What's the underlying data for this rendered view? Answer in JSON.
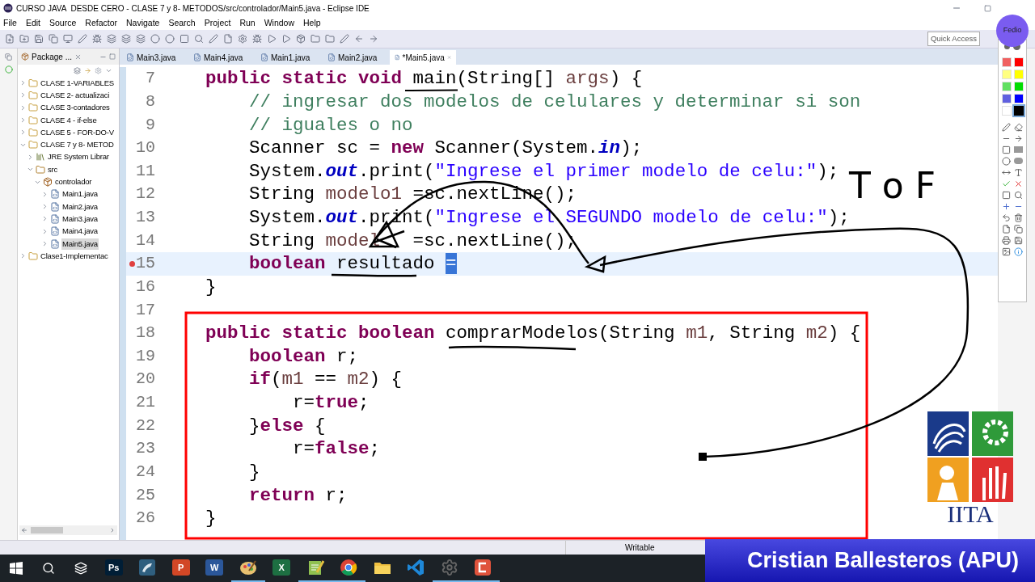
{
  "window": {
    "title": "CURSO JAVA  DESDE CERO - CLASE 7 y 8- METODOS/src/controlador/Main5.java - Eclipse IDE"
  },
  "menu": [
    "File",
    "Edit",
    "Source",
    "Refactor",
    "Navigate",
    "Search",
    "Project",
    "Run",
    "Window",
    "Help"
  ],
  "quick_access": {
    "placeholder": "Quick Access"
  },
  "package_explorer": {
    "title": "Package ...",
    "tree": [
      {
        "label": "CLASE 1-VARIABLES",
        "kind": "project",
        "expanded": false,
        "selected": false
      },
      {
        "label": "CLASE 2- actualizaci",
        "kind": "project",
        "expanded": false,
        "selected": false
      },
      {
        "label": "CLASE 3-contadores",
        "kind": "project",
        "expanded": false,
        "selected": false
      },
      {
        "label": "CLASE 4 - if-else",
        "kind": "project",
        "expanded": false,
        "selected": false
      },
      {
        "label": "CLASE 5 - FOR-DO-V",
        "kind": "project",
        "expanded": false,
        "selected": false
      },
      {
        "label": "CLASE 7 y 8- METOD",
        "kind": "project",
        "expanded": true,
        "selected": false,
        "children": [
          {
            "label": "JRE System Librar",
            "kind": "library",
            "expanded": false,
            "selected": false
          },
          {
            "label": "src",
            "kind": "folder",
            "expanded": true,
            "selected": false,
            "children": [
              {
                "label": "controlador",
                "kind": "package",
                "expanded": true,
                "selected": false,
                "children": [
                  {
                    "label": "Main1.java",
                    "kind": "file",
                    "expanded": false,
                    "selected": false
                  },
                  {
                    "label": "Main2.java",
                    "kind": "file",
                    "expanded": false,
                    "selected": false
                  },
                  {
                    "label": "Main3.java",
                    "kind": "file",
                    "expanded": false,
                    "selected": false
                  },
                  {
                    "label": "Main4.java",
                    "kind": "file",
                    "expanded": false,
                    "selected": false
                  },
                  {
                    "label": "Main5.java",
                    "kind": "file",
                    "expanded": false,
                    "selected": true
                  }
                ]
              }
            ]
          }
        ]
      },
      {
        "label": "Clase1-Implementac",
        "kind": "project",
        "expanded": false,
        "selected": false
      }
    ]
  },
  "editor": {
    "tabs": [
      {
        "label": "Main3.java",
        "selected": false
      },
      {
        "label": "Main4.java",
        "selected": false
      },
      {
        "label": "Main1.java",
        "selected": false
      },
      {
        "label": "Main2.java",
        "selected": false
      },
      {
        "label": "*Main5.java",
        "selected": true
      }
    ],
    "lines": [
      {
        "number": "7",
        "current": false,
        "error": false,
        "tokens": [
          {
            "text": "    public static void",
            "kind": "kw"
          },
          {
            "text": " main(String[] ",
            "kind": "txt"
          },
          {
            "text": "args",
            "kind": "var"
          },
          {
            "text": ") {",
            "kind": "txt"
          }
        ]
      },
      {
        "number": "8",
        "current": false,
        "error": false,
        "tokens": [
          {
            "text": "        // ingresar dos modelos de celulares y determinar si son",
            "kind": "cm"
          }
        ]
      },
      {
        "number": "9",
        "current": false,
        "error": false,
        "tokens": [
          {
            "text": "        // iguales o no",
            "kind": "cm"
          }
        ]
      },
      {
        "number": "10",
        "current": false,
        "error": false,
        "tokens": [
          {
            "text": "        Scanner sc = ",
            "kind": "txt"
          },
          {
            "text": "new",
            "kind": "kw"
          },
          {
            "text": " Scanner(System.",
            "kind": "txt"
          },
          {
            "text": "in",
            "kind": "fld"
          },
          {
            "text": ");",
            "kind": "txt"
          }
        ]
      },
      {
        "number": "11",
        "current": false,
        "error": false,
        "tokens": [
          {
            "text": "        System.",
            "kind": "txt"
          },
          {
            "text": "out",
            "kind": "fld"
          },
          {
            "text": ".print(",
            "kind": "txt"
          },
          {
            "text": "\"Ingrese el primer modelo de celu:\"",
            "kind": "str"
          },
          {
            "text": ");",
            "kind": "txt"
          }
        ]
      },
      {
        "number": "12",
        "current": false,
        "error": false,
        "tokens": [
          {
            "text": "        String ",
            "kind": "txt"
          },
          {
            "text": "modelo1",
            "kind": "var"
          },
          {
            "text": " =sc.nextLine();",
            "kind": "txt"
          }
        ]
      },
      {
        "number": "13",
        "current": false,
        "error": false,
        "tokens": [
          {
            "text": "        System.",
            "kind": "txt"
          },
          {
            "text": "out",
            "kind": "fld"
          },
          {
            "text": ".print(",
            "kind": "txt"
          },
          {
            "text": "\"Ingrese el SEGUNDO modelo de celu:\"",
            "kind": "str"
          },
          {
            "text": ");",
            "kind": "txt"
          }
        ]
      },
      {
        "number": "14",
        "current": false,
        "error": false,
        "tokens": [
          {
            "text": "        String ",
            "kind": "txt"
          },
          {
            "text": "model",
            "kind": "var"
          },
          {
            "text": "   =sc.nextLine();",
            "kind": "txt"
          }
        ]
      },
      {
        "number": "15",
        "current": true,
        "error": true,
        "tokens": [
          {
            "text": "        boolean",
            "kind": "kw"
          },
          {
            "text": " resultado ",
            "kind": "txt"
          },
          {
            "text": "=",
            "kind": "sel"
          }
        ]
      },
      {
        "number": "16",
        "current": false,
        "error": false,
        "tokens": [
          {
            "text": "    }",
            "kind": "txt"
          }
        ]
      },
      {
        "number": "17",
        "current": false,
        "error": false
      },
      {
        "number": "18",
        "current": false,
        "error": false,
        "tokens": [
          {
            "text": "    public static boolean",
            "kind": "kw"
          },
          {
            "text": " comprarModelos(String ",
            "kind": "txt"
          },
          {
            "text": "m1",
            "kind": "var"
          },
          {
            "text": ", String ",
            "kind": "txt"
          },
          {
            "text": "m2",
            "kind": "var"
          },
          {
            "text": ") {",
            "kind": "txt"
          }
        ]
      },
      {
        "number": "19",
        "current": false,
        "error": false,
        "tokens": [
          {
            "text": "        boolean",
            "kind": "kw"
          },
          {
            "text": " r;",
            "kind": "txt"
          }
        ]
      },
      {
        "number": "20",
        "current": false,
        "error": false,
        "tokens": [
          {
            "text": "        if",
            "kind": "kw"
          },
          {
            "text": "(",
            "kind": "txt"
          },
          {
            "text": "m1",
            "kind": "var"
          },
          {
            "text": " == ",
            "kind": "txt"
          },
          {
            "text": "m2",
            "kind": "var"
          },
          {
            "text": ") {",
            "kind": "txt"
          }
        ]
      },
      {
        "number": "21",
        "current": false,
        "error": false,
        "tokens": [
          {
            "text": "            r=",
            "kind": "txt"
          },
          {
            "text": "true",
            "kind": "kw"
          },
          {
            "text": ";",
            "kind": "txt"
          }
        ]
      },
      {
        "number": "22",
        "current": false,
        "error": false,
        "tokens": [
          {
            "text": "        }",
            "kind": "txt"
          },
          {
            "text": "else",
            "kind": "kw"
          },
          {
            "text": " {",
            "kind": "txt"
          }
        ]
      },
      {
        "number": "23",
        "current": false,
        "error": false,
        "tokens": [
          {
            "text": "            r=",
            "kind": "txt"
          },
          {
            "text": "false",
            "kind": "kw"
          },
          {
            "text": ";",
            "kind": "txt"
          }
        ]
      },
      {
        "number": "24",
        "current": false,
        "error": false,
        "tokens": [
          {
            "text": "        }",
            "kind": "txt"
          }
        ]
      },
      {
        "number": "25",
        "current": false,
        "error": false,
        "tokens": [
          {
            "text": "        return",
            "kind": "kw"
          },
          {
            "text": " r;",
            "kind": "txt"
          }
        ]
      },
      {
        "number": "26",
        "current": false,
        "error": false,
        "tokens": [
          {
            "text": "    }",
            "kind": "txt"
          }
        ]
      }
    ]
  },
  "annotation": {
    "text": "T o F"
  },
  "pen_palette": {
    "tooltip": "Fedio",
    "swatches": [
      {
        "color": "#f06060",
        "selected": false
      },
      {
        "color": "#ff0000",
        "selected": false
      },
      {
        "color": "#ffff80",
        "selected": false
      },
      {
        "color": "#ffff00",
        "selected": false
      },
      {
        "color": "#60e060",
        "selected": false
      },
      {
        "color": "#00dd00",
        "selected": false
      },
      {
        "color": "#6060e0",
        "selected": false
      },
      {
        "color": "#0000ff",
        "selected": false
      },
      {
        "color": "#ffffff",
        "selected": false
      },
      {
        "color": "#000000",
        "selected": true
      }
    ]
  },
  "logo": {
    "text": "IITA"
  },
  "status_bar": {
    "mode": "Writable"
  },
  "presenter": {
    "name": "Cristian Ballesteros (APU)"
  },
  "taskbar": [
    {
      "kind": "letter",
      "glyph": "Ps",
      "color": "#001e36",
      "running": false
    },
    {
      "kind": "dolphin",
      "color": "#2f5f7f",
      "running": false
    },
    {
      "kind": "letter",
      "glyph": "P",
      "color": "#d24726",
      "running": false
    },
    {
      "kind": "letter",
      "glyph": "W",
      "color": "#2b579a",
      "running": false
    },
    {
      "kind": "palette",
      "color": "#e8c070",
      "running": true
    },
    {
      "kind": "letter",
      "glyph": "X",
      "color": "#1d6f42",
      "running": false
    },
    {
      "kind": "notepad",
      "color": "#8fc050",
      "running": true
    },
    {
      "kind": "chrome",
      "color": "#db4437",
      "running": true
    },
    {
      "kind": "folder",
      "color": "#f0c040",
      "running": false
    },
    {
      "kind": "vscode",
      "color": "#1e88d8",
      "running": false
    },
    {
      "kind": "gear",
      "color": "#666666",
      "running": true
    },
    {
      "kind": "camtasia",
      "color": "#e0533c",
      "running": true
    }
  ]
}
